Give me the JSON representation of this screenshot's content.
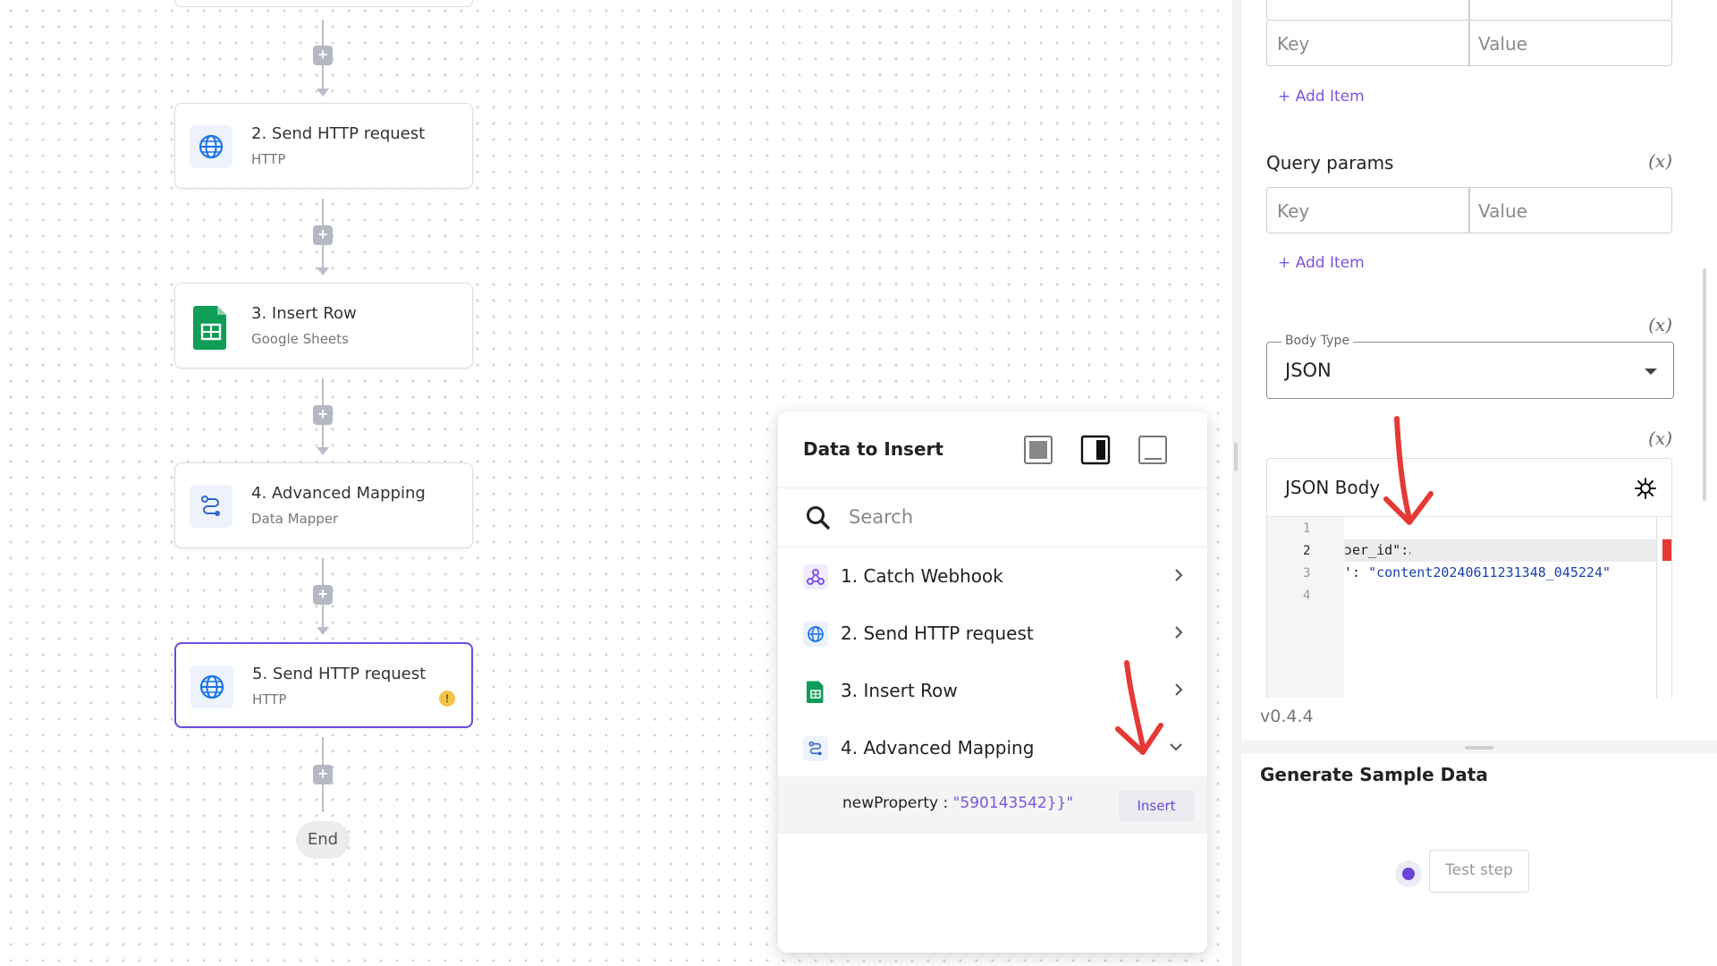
{
  "canvas": {
    "steps": [
      {
        "title": "2. Send HTTP request",
        "subtitle": "HTTP",
        "icon": "globe-icon"
      },
      {
        "title": "3. Insert Row",
        "subtitle": "Google Sheets",
        "icon": "google-sheets-icon"
      },
      {
        "title": "4. Advanced Mapping",
        "subtitle": "Data Mapper",
        "icon": "data-mapper-icon"
      },
      {
        "title": "5. Send HTTP request",
        "subtitle": "HTTP",
        "icon": "globe-icon",
        "warning": "!"
      }
    ],
    "end_label": "End",
    "add_step_symbol": "+"
  },
  "data_popup": {
    "title": "Data to Insert",
    "layout_options": [
      "layout-full-icon",
      "layout-side-icon",
      "layout-bottom-icon"
    ],
    "search_placeholder": "Search",
    "items": [
      {
        "label": "1. Catch Webhook",
        "icon": "webhook-icon"
      },
      {
        "label": "2. Send HTTP request",
        "icon": "globe-icon"
      },
      {
        "label": "3. Insert Row",
        "icon": "google-sheets-icon"
      },
      {
        "label": "4. Advanced Mapping",
        "icon": "data-mapper-icon",
        "expanded": true
      }
    ],
    "property": {
      "key": "newProperty :",
      "value": "\"590143542}}\"",
      "insert_label": "Insert"
    }
  },
  "settings_panel": {
    "headers_row": {
      "key_placeholder": "Key",
      "value_placeholder": "Value"
    },
    "add_item_label": "+ Add Item",
    "query_params": {
      "label": "Query params",
      "var_badge": "(x)",
      "key_placeholder": "Key",
      "value_placeholder": "Value"
    },
    "body_type": {
      "legend": "Body Type",
      "value": "JSON",
      "var_badge": "(x)"
    },
    "json_body": {
      "label": "JSON Body",
      "var_badge": "(x)",
      "line_numbers": [
        "1",
        "2",
        "3",
        "4"
      ],
      "current_line": "2",
      "lines": [
        {
          "plain": "",
          "str": ""
        },
        {
          "plain": "ɔer_id\":",
          "str": ""
        },
        {
          "plain": "': ",
          "str": "\"content20240611231348_045224\""
        },
        {
          "plain": "",
          "str": ""
        }
      ]
    },
    "version": "v0.4.4",
    "generate_sample": {
      "title": "Generate Sample Data",
      "test_button": "Test step"
    }
  },
  "colors": {
    "accent": "#6c4bd8",
    "annotation_arrow": "#e53935",
    "sheets_green": "#0f9d58",
    "globe_blue": "#1a73e8"
  }
}
